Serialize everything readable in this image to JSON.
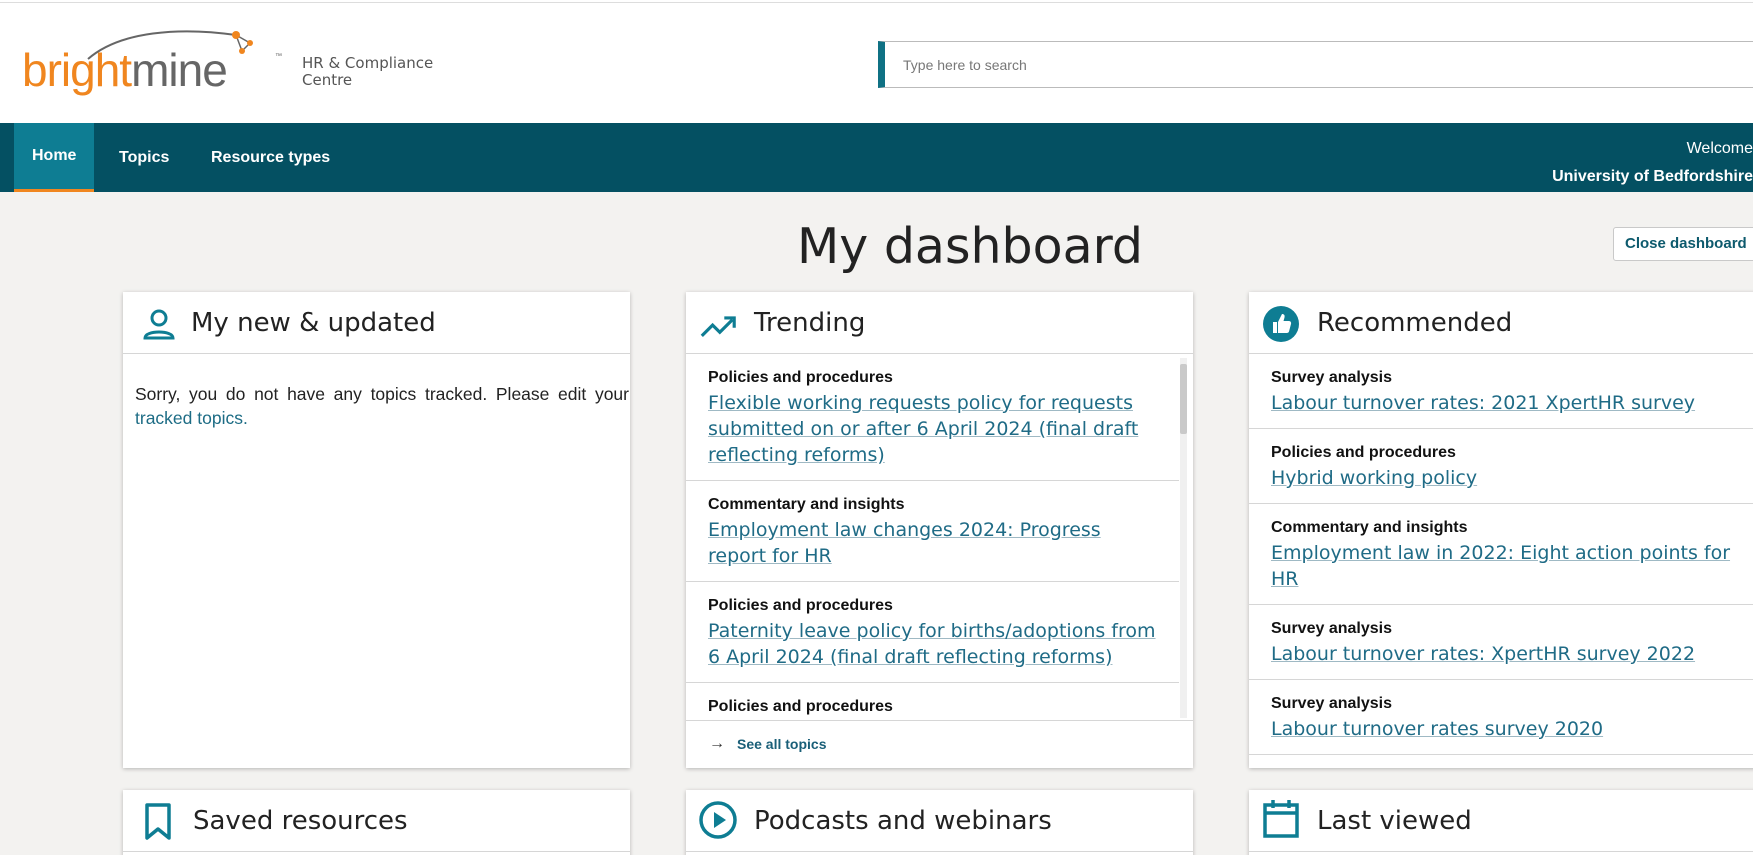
{
  "header": {
    "logo": {
      "part1": "bright",
      "part2": "mine",
      "tm": "™"
    },
    "tagline": "HR & Compliance Centre",
    "search_placeholder": "Type here to search"
  },
  "nav": {
    "items": [
      {
        "label": "Home",
        "active": true
      },
      {
        "label": "Topics",
        "active": false
      },
      {
        "label": "Resource types",
        "active": false
      }
    ],
    "welcome": "Welcome",
    "org": "University of Bedfordshire"
  },
  "main": {
    "title": "My dashboard",
    "close_label": "Close dashboard"
  },
  "cards": {
    "new_updated": {
      "title": "My new & updated",
      "icon": "person-icon",
      "message": "Sorry, you do not have any topics tracked. Please edit your ",
      "link": "tracked topics."
    },
    "trending": {
      "title": "Trending",
      "icon": "trending-up-icon",
      "items": [
        {
          "category": "Policies and procedures",
          "title": "Flexible working requests policy for requests submitted on or after 6 April 2024 (final draft reflecting reforms)"
        },
        {
          "category": "Commentary and insights",
          "title": "Employment law changes 2024: Progress report for HR"
        },
        {
          "category": "Policies and procedures",
          "title": "Paternity leave policy for births/adoptions from 6 April 2024 (final draft reflecting reforms)"
        },
        {
          "category": "Policies and procedures",
          "title": ""
        }
      ],
      "see_all": "See all topics"
    },
    "recommended": {
      "title": "Recommended",
      "icon": "thumbs-up-icon",
      "items": [
        {
          "category": "Survey analysis",
          "title": "Labour turnover rates: 2021 XpertHR survey"
        },
        {
          "category": "Policies and procedures",
          "title": "Hybrid working policy"
        },
        {
          "category": "Commentary and insights",
          "title": "Employment law in 2022: Eight action points for HR"
        },
        {
          "category": "Survey analysis",
          "title": "Labour turnover rates: XpertHR survey 2022"
        },
        {
          "category": "Survey analysis",
          "title": "Labour turnover rates survey 2020"
        }
      ]
    },
    "saved": {
      "title": "Saved resources",
      "icon": "bookmark-icon"
    },
    "podcasts": {
      "title": "Podcasts and webinars",
      "icon": "play-circle-icon"
    },
    "last_viewed": {
      "title": "Last viewed",
      "icon": "calendar-icon"
    }
  },
  "colors": {
    "brand_orange": "#f0861f",
    "nav_teal": "#045062",
    "active_teal": "#0e7d93",
    "link": "#1f6b86"
  }
}
